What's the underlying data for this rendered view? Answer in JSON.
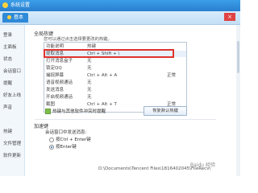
{
  "window": {
    "title": "系统设置",
    "close_glyph": "×"
  },
  "tabs": [
    {
      "label": "基本"
    }
  ],
  "sidebar": {
    "items": [
      {
        "label": "登录"
      },
      {
        "label": "主面板"
      },
      {
        "label": "状态"
      },
      {
        "label": "会话窗口"
      },
      {
        "label": "提醒"
      },
      {
        "label": "好友上线"
      },
      {
        "label": "声音"
      },
      {
        "label": "热键"
      },
      {
        "label": "文件管理"
      },
      {
        "label": "软件更新"
      }
    ]
  },
  "hotkeys": {
    "section_title": "全局热键",
    "hint": "您可以通过点击选择要更改的热键。",
    "rows": [
      {
        "name": "功能说明",
        "key": "热键",
        "status": ""
      },
      {
        "name": "提取消息",
        "key": "Ctrl + Shift + \\",
        "status": ""
      },
      {
        "name": "打开消息盒子",
        "key": "无",
        "status": ""
      },
      {
        "name": "锁定QQ",
        "key": "无",
        "status": ""
      },
      {
        "name": "捕捉屏幕",
        "key": "Ctrl + Alt + A",
        "status": "正常"
      },
      {
        "name": "语音视频通话",
        "key": "无",
        "status": ""
      },
      {
        "name": "发送消息",
        "key": "无",
        "status": ""
      },
      {
        "name": "开启视频通话",
        "key": "无",
        "status": ""
      },
      {
        "name": "截图",
        "key": "Ctrl + Alt + T",
        "status": "正常"
      }
    ],
    "conflict_checkbox_label": "热键与其他软件冲突时提醒",
    "restore_button_label": "恢复默认热键"
  },
  "send_key": {
    "section_title": "加速键",
    "subtitle": "会话窗口中发送消息:",
    "options": [
      {
        "label": "按Ctrl + Enter键",
        "checked": false
      },
      {
        "label": "按Enter键",
        "checked": true
      }
    ]
  },
  "file_path": "D:\\Documents\\Tencent Files\\1816402045\\FileRecv\\",
  "watermark": "Baidu 经验"
}
